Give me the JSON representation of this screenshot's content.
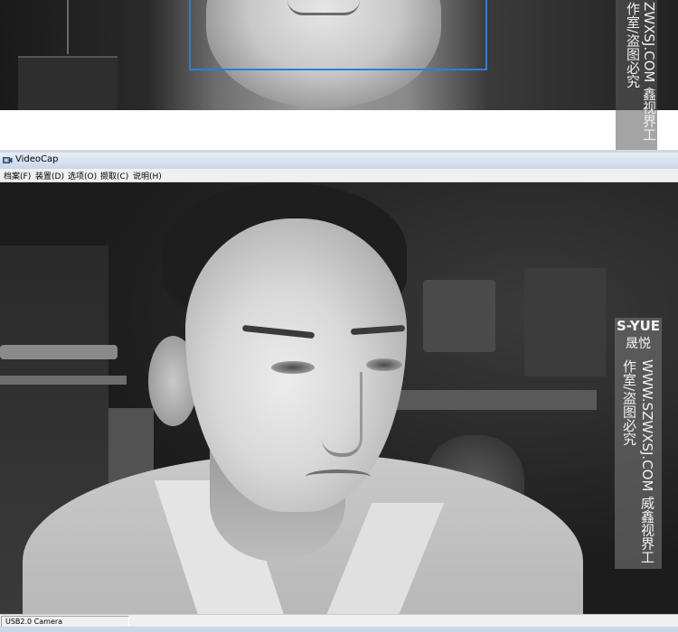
{
  "top_watermark": {
    "text": "ZWXSJ.COM 鑫视界工作室/盗图必究"
  },
  "window": {
    "title": "VideoCap",
    "menu": [
      "档案(F)",
      "装置(D)",
      "选项(O)",
      "撷取(C)",
      "说明(H)"
    ],
    "status": "USB2.0 Camera"
  },
  "watermark": {
    "brand_en": "S-YUE",
    "brand_cn": "晟悦",
    "site": "WWW.SZWXSJ.COM",
    "studio": "威鑫视界工作室/盗图必究"
  },
  "colors": {
    "face_detect_box": "#2b7fd6",
    "title_bar": "#c9d7e8"
  },
  "icons": [
    "camera-app-icon"
  ]
}
